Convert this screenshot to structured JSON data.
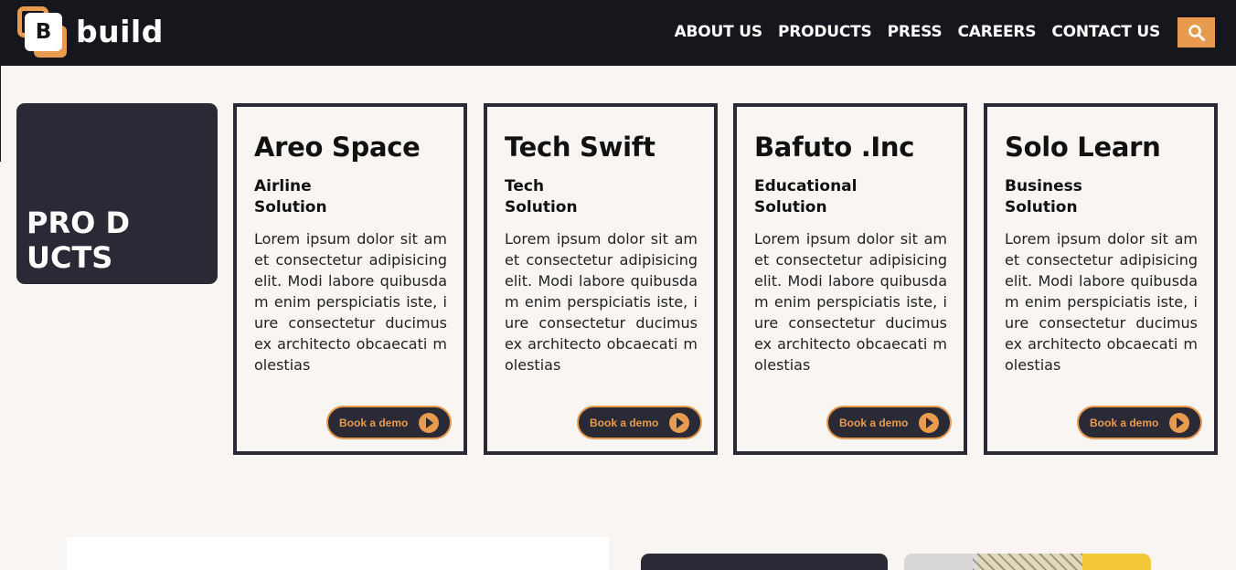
{
  "brand": {
    "logo_letter": "B",
    "name": "build"
  },
  "nav": {
    "items": [
      "ABOUT US",
      "PRODUCTS",
      "PRESS",
      "CAREERS",
      "CONTACT US"
    ]
  },
  "products_heading": "PRO DUCTS",
  "cards": [
    {
      "title": "Areo Space",
      "subtitle": "Airline Solution",
      "description": "Lorem ipsum dolor sit amet consectetur adipisicing elit. Modi labore quibusdam enim perspiciatis iste, iure consectetur ducimus ex architecto obcaecati molestias",
      "button": "Book a demo"
    },
    {
      "title": "Tech Swift",
      "subtitle": "Tech Solution",
      "description": "Lorem ipsum dolor sit amet consectetur adipisicing elit. Modi labore quibusdam enim perspiciatis iste, iure consectetur ducimus ex architecto obcaecati molestias",
      "button": "Book a demo"
    },
    {
      "title": "Bafuto .Inc",
      "subtitle": "Educational Solution",
      "description": "Lorem ipsum dolor sit amet consectetur adipisicing elit. Modi labore quibusdam enim perspiciatis iste, iure consectetur ducimus ex architecto obcaecati molestias",
      "button": "Book a demo"
    },
    {
      "title": "Solo Learn",
      "subtitle": "Business Solution",
      "description": "Lorem ipsum dolor sit amet consectetur adipisicing elit. Modi labore quibusdam enim perspiciatis iste, iure consectetur ducimus ex architecto obcaecati molestias",
      "button": "Book a demo"
    }
  ],
  "colors": {
    "accent": "#e89a4e",
    "dark": "#292a35",
    "header": "#16171d",
    "background": "#f8f5f2"
  },
  "icons": {
    "search": "search-icon",
    "play": "play-icon"
  }
}
